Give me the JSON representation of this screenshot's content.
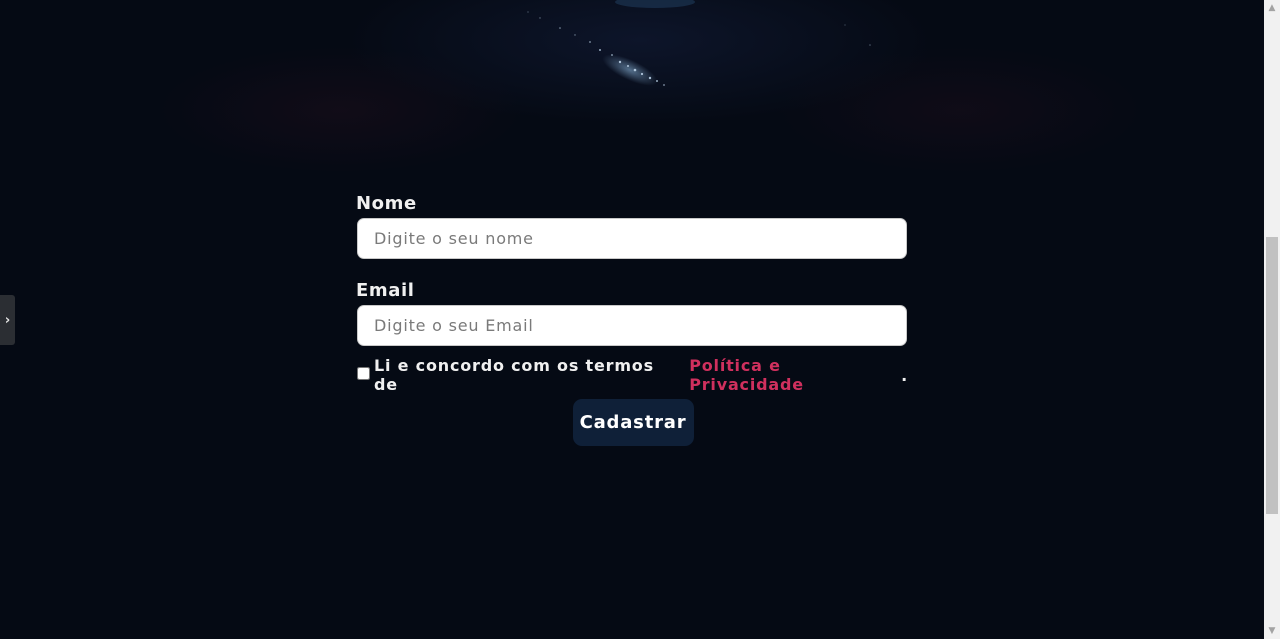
{
  "form": {
    "name_label": "Nome",
    "name_placeholder": "Digite o seu nome",
    "email_label": "Email",
    "email_placeholder": "Digite o seu Email",
    "terms_text": "Li e concordo com os termos de",
    "terms_link": "Política e Privacidade",
    "terms_end": ".",
    "terms_checked": false,
    "submit_label": "Cadastrar"
  },
  "side_handle": {
    "glyph": "›",
    "icon": "chevron-right-icon"
  },
  "colors": {
    "background": "#050a14",
    "link": "#d0305e",
    "button": "#0f2038"
  }
}
